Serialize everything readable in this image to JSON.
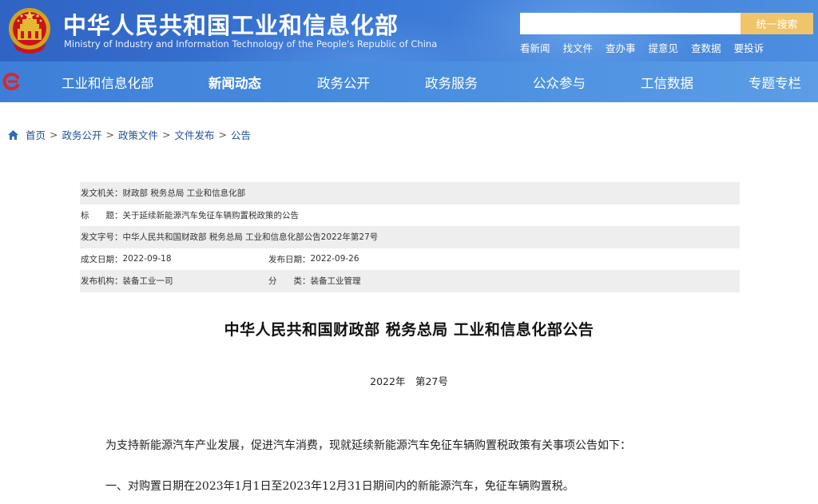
{
  "header": {
    "title": "中华人民共和国工业和信息化部",
    "subtitle": "Ministry of Industry and Information Technology of the People's Republic of China",
    "search_placeholder": "",
    "search_button": "统一搜索",
    "quick_links": [
      "看新闻",
      "找文件",
      "查办事",
      "提意见",
      "查数据",
      "要投诉"
    ]
  },
  "nav": {
    "items": [
      "工业和信息化部",
      "新闻动态",
      "政务公开",
      "政务服务",
      "公众参与",
      "工信数据",
      "专题专栏"
    ],
    "active": "新闻动态"
  },
  "breadcrumb": {
    "items": [
      "首页",
      "政务公开",
      "政策文件",
      "文件发布",
      "公告"
    ],
    "separator": ">"
  },
  "info": {
    "issuer_label": "发文机关：",
    "issuer": "财政部 税务总局 工业和信息化部",
    "title_label": "标　　题：",
    "title": "关于延续新能源汽车免征车辆购置税政策的公告",
    "doc_no_label": "发文字号：",
    "doc_no": "中华人民共和国财政部 税务总局 工业和信息化部公告2022年第27号",
    "written_label": "成文日期：",
    "written_date": "2022-09-18",
    "published_label": "发布日期：",
    "published_date": "2022-09-26",
    "org_label": "发布机构：",
    "org": "装备工业一司",
    "category_label": "分　　类：",
    "category": "装备工业管理"
  },
  "document": {
    "title": "中华人民共和国财政部 税务总局 工业和信息化部公告",
    "number": "2022年　第27号",
    "paragraphs": [
      "为支持新能源汽车产业发展，促进汽车消费，现就延续新能源汽车免征车辆购置税政策有关事项公告如下：",
      "一、对购置日期在2023年1月1日至2023年12月31日期间内的新能源汽车，免征车辆购置税。"
    ]
  },
  "colors": {
    "header_blue": "#3a78d6",
    "nav_blue": "#4a8fe0",
    "search_button": "#f0c46a",
    "table_shade": "#eeeeee",
    "link_blue": "#1f4f9c"
  },
  "icons": [
    "national-emblem-icon",
    "nav-logo-icon",
    "home-icon"
  ]
}
